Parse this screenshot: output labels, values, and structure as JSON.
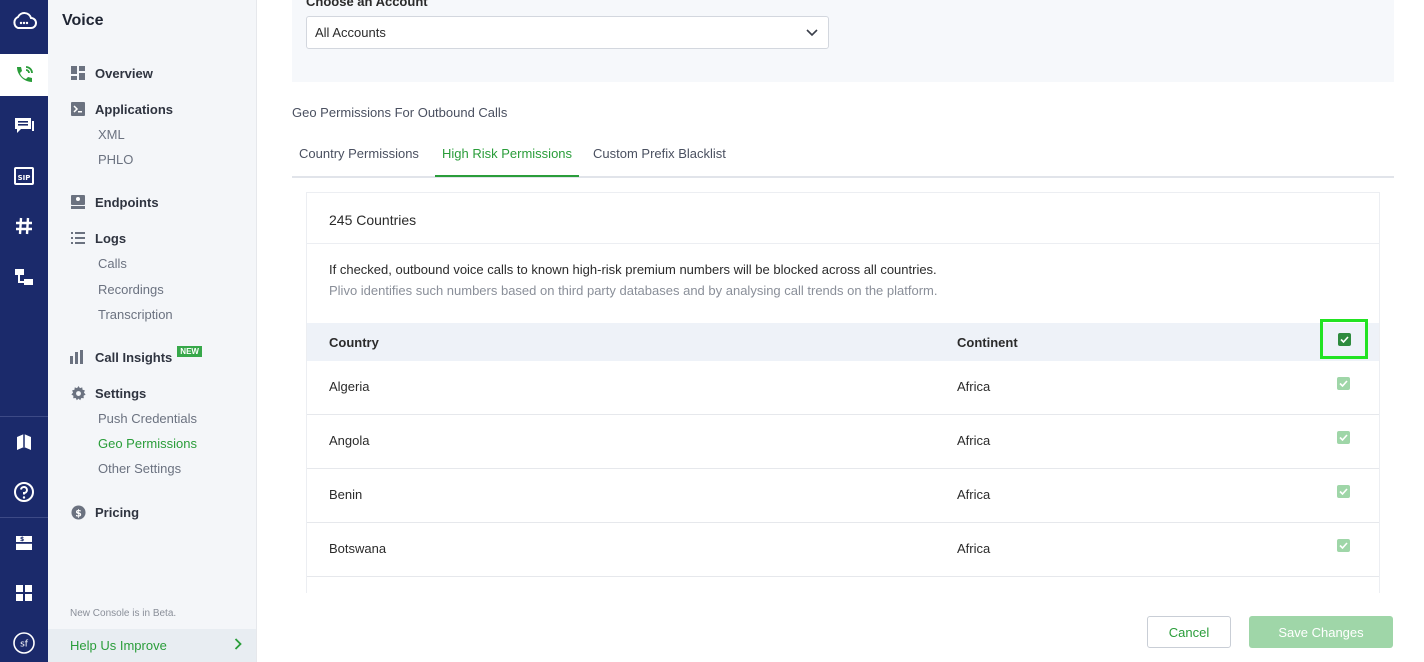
{
  "sidebar": {
    "title": "Voice",
    "items": [
      {
        "label": "Overview",
        "icon": "dashboard-icon"
      },
      {
        "label": "Applications",
        "icon": "terminal-icon",
        "subitems": [
          "XML",
          "PHLO"
        ]
      },
      {
        "label": "Endpoints",
        "icon": "endpoint-icon"
      },
      {
        "label": "Logs",
        "icon": "list-icon",
        "subitems": [
          "Calls",
          "Recordings",
          "Transcription"
        ]
      },
      {
        "label": "Call Insights",
        "icon": "bar-chart-icon",
        "badge": "NEW"
      },
      {
        "label": "Settings",
        "icon": "gear-icon",
        "subitems": [
          "Push Credentials",
          "Geo Permissions",
          "Other Settings"
        ],
        "active_subitem": "Geo Permissions"
      },
      {
        "label": "Pricing",
        "icon": "dollar-icon"
      }
    ],
    "beta_note": "New Console is in Beta.",
    "help": "Help Us Improve"
  },
  "account": {
    "label": "Choose an Account",
    "selected": "All Accounts"
  },
  "section_title": "Geo Permissions For Outbound Calls",
  "tabs": [
    {
      "label": "Country Permissions",
      "active": false
    },
    {
      "label": "High Risk Permissions",
      "active": true
    },
    {
      "label": "Custom Prefix Blacklist",
      "active": false
    }
  ],
  "card": {
    "count": "245 Countries",
    "note_primary": "If checked, outbound voice calls to known high-risk premium numbers will be blocked across all countries.",
    "note_secondary": "Plivo identifies such numbers based on third party databases and by analysing call trends on the platform."
  },
  "table": {
    "headers": [
      "Country",
      "Continent"
    ],
    "header_checked": true,
    "rows": [
      {
        "country": "Algeria",
        "continent": "Africa",
        "checked": true
      },
      {
        "country": "Angola",
        "continent": "Africa",
        "checked": true
      },
      {
        "country": "Benin",
        "continent": "Africa",
        "checked": true
      },
      {
        "country": "Botswana",
        "continent": "Africa",
        "checked": true
      }
    ]
  },
  "footer": {
    "cancel": "Cancel",
    "save": "Save Changes"
  },
  "colors": {
    "rail": "#1b2a6b",
    "accent_green": "#2a9d3a",
    "highlight": "#22e322"
  }
}
